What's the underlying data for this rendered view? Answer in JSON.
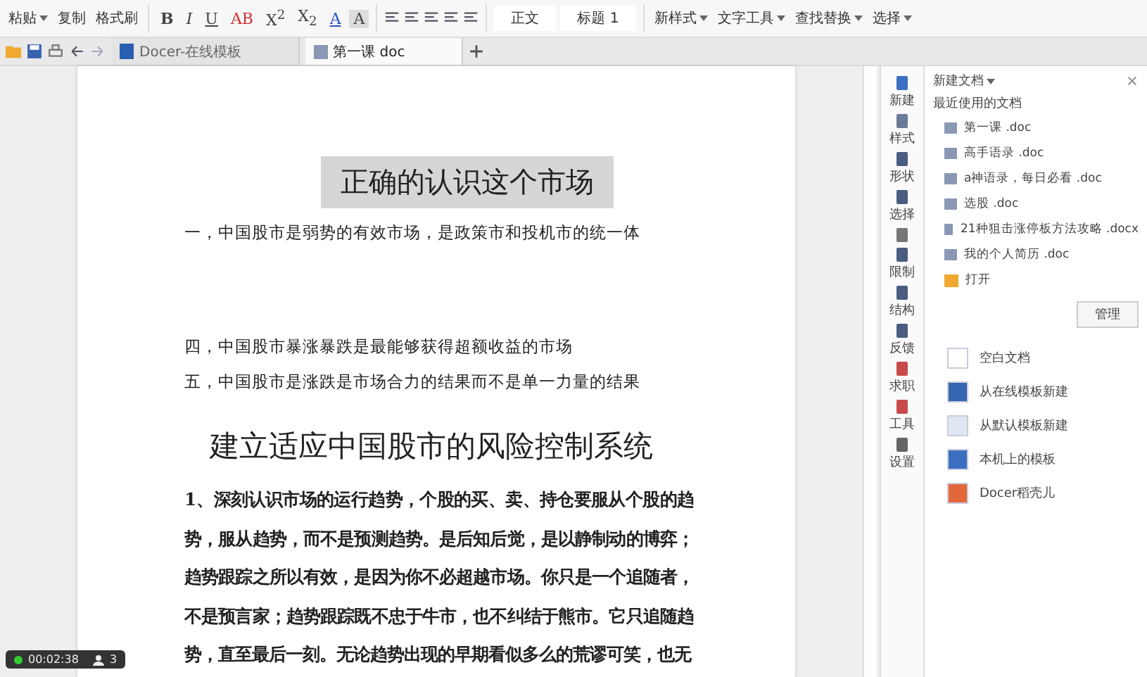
{
  "ribbon": {
    "clipboard": [
      {
        "label": "粘贴",
        "caret": true
      },
      {
        "label": "复制",
        "caret": false
      },
      {
        "label": "格式刷",
        "caret": false
      }
    ],
    "font_buttons": [
      {
        "label": "B",
        "kind": "bold"
      },
      {
        "label": "I",
        "kind": "italic"
      },
      {
        "label": "U",
        "kind": "underline"
      },
      {
        "label": "AB",
        "kind": "strike"
      },
      {
        "label": "X$^{2}$",
        "kind": "plain"
      },
      {
        "label": "X$_{2}$",
        "kind": "plain"
      },
      {
        "label": "A",
        "kind": "color"
      },
      {
        "label": "A",
        "kind": "shade"
      }
    ],
    "styles": [
      "正文",
      "标题 1"
    ],
    "tools": [
      "新样式",
      "文字工具",
      "查找替换",
      "选择"
    ]
  },
  "tabs": [
    {
      "label": "Docer-在线模板",
      "selected": false,
      "kind": "docer"
    },
    {
      "label": "第一课 doc",
      "selected": true,
      "kind": "doc"
    }
  ],
  "document": {
    "title": "正确的认识这个市场",
    "title_selected": true,
    "points": [
      "一，中国股市是弱势的有效市场，是政策市和投机市的统一体",
      "四，中国股市暴涨暴跌是最能够获得超额收益的市场",
      "五，中国股市是涨跌是市场合力的结果而不是单一力量的结果"
    ],
    "heading": "建立适应中国股市的风险控制系统",
    "paragraph": "1、深刻认识市场的运行趋势，个股的买、卖、持仓要服从个股的趋势，服从趋势，而不是预测趋势。是后知后觉，是以静制动的博弈；趋势跟踪之所以有效，是因为你不必超越市场。你只是一个追随者，不是预言家；趋势跟踪既不忠于牛市，也不纠结于熊市。它只追随趋势，直至最后一刻。无论趋势出现的早期看似多么的荒谬可笑，也无"
  },
  "side_nav": [
    {
      "label": "新建",
      "kind": "doc"
    },
    {
      "label": "样式",
      "kind": "style"
    },
    {
      "label": "形状",
      "kind": "shape"
    },
    {
      "label": "选择",
      "kind": "select"
    },
    {
      "kind": "clip"
    },
    {
      "label": "限制",
      "kind": "lock"
    },
    {
      "label": "结构",
      "kind": "outline"
    },
    {
      "label": "反馈",
      "kind": "chat"
    },
    {
      "label": "求职",
      "kind": "case"
    },
    {
      "label": "工具",
      "kind": "case"
    },
    {
      "label": "设置",
      "kind": "gear"
    }
  ],
  "panel": {
    "title": "新建文档",
    "recent_heading": "最近使用的文档",
    "recent": [
      "第一课 .doc",
      "高手语录 .doc",
      "a神语录，每日必看 .doc",
      "选股 .doc",
      "21种狙击涨停板方法攻略 .docx",
      "我的个人简历 .doc"
    ],
    "open": "打开",
    "manage": "管理",
    "create": [
      {
        "label": "空白文档",
        "kind": "blank"
      },
      {
        "label": "从在线模板新建",
        "kind": "docer"
      },
      {
        "label": "从默认模板新建",
        "kind": "template"
      },
      {
        "label": "本机上的模板",
        "kind": "local"
      },
      {
        "label": "Docer稻壳儿",
        "kind": "shell"
      }
    ]
  },
  "recorder": {
    "time": "00:02:38",
    "viewers": "3"
  }
}
